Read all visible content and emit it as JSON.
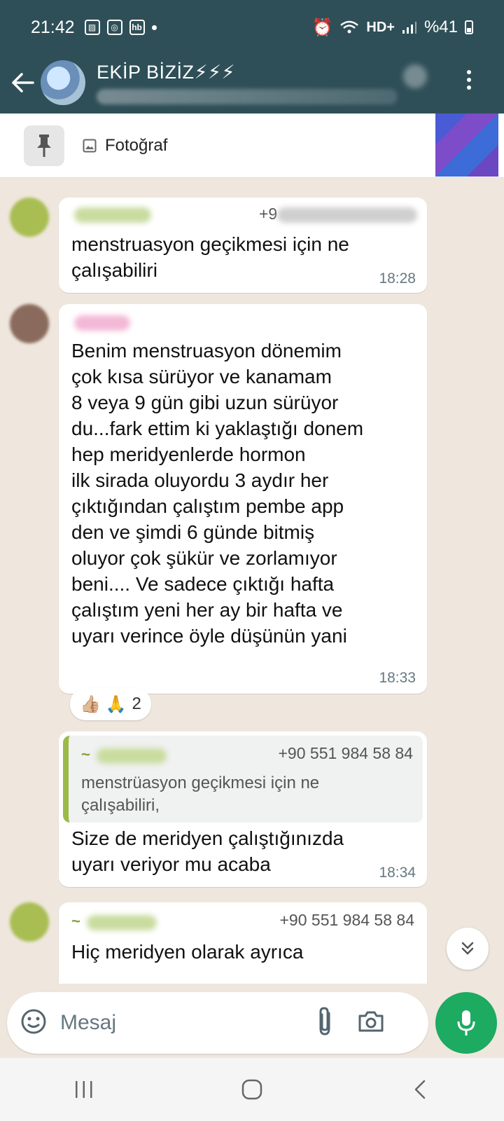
{
  "status_bar": {
    "time": "21:42",
    "network": "HD+",
    "battery": "%41"
  },
  "header": {
    "group_name": "EKİP BİZİZ⚡⚡⚡"
  },
  "pinned": {
    "label": "Fotoğraf"
  },
  "messages": [
    {
      "phone_partial": "+9",
      "text": "menstruasyon geçikmesi için ne\nçalışabiliri",
      "time": "18:28"
    },
    {
      "text": "Benim menstruasyon dönemim\nçok kısa sürüyor ve  kanamam\n8 veya 9 gün gibi uzun sürüyor\ndu...fark ettim ki yaklaştığı donem\nhep meridyenlerde hormon\nilk sirada oluyordu 3 aydır her\nçıktığından çalıştım pembe app\nden ve şimdi 6 günde bitmiş\noluyor çok şükür ve zorlamıyor\nbeni.... Ve sadece çıktığı hafta\nçalıştım yeni her ay bir hafta ve\nuyarı verince öyle düşünün yani",
      "time": "18:33",
      "reactions": {
        "emojis": "👍🏼 🙏",
        "count": "2"
      }
    },
    {
      "quote": {
        "sender_prefix": "~",
        "phone": "+90 551 984 58 84",
        "text": "menstrüasyon geçikmesi için ne\nçalışabiliri,"
      },
      "text": "Size de meridyen çalıştığınızda\nuyarı veriyor mu acaba",
      "time": "18:34"
    },
    {
      "sender_prefix": "~",
      "phone": "+90 551 984 58 84",
      "text": "Hiç meridyen olarak ayrıca"
    }
  ],
  "composer": {
    "placeholder": "Mesaj"
  },
  "colors": {
    "header_bg": "#2f4f58",
    "chat_bg": "#efe7dd",
    "accent_green": "#1daa61",
    "quote_bar": "#9cba49"
  }
}
